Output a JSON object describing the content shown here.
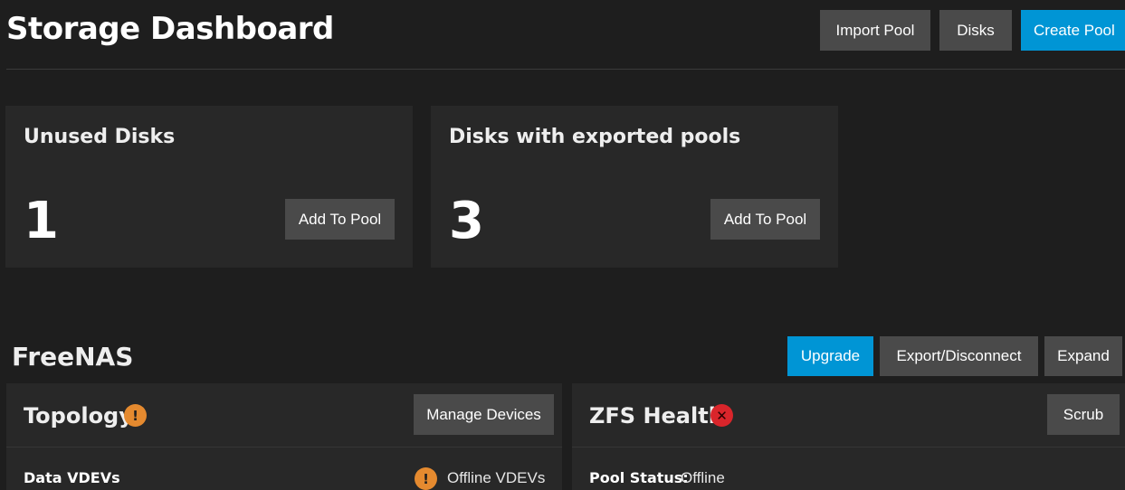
{
  "header": {
    "title": "Storage Dashboard",
    "buttons": {
      "import_pool": "Import Pool",
      "disks": "Disks",
      "create_pool": "Create Pool"
    }
  },
  "summary_cards": [
    {
      "title": "Unused Disks",
      "count": "1",
      "button": "Add To Pool"
    },
    {
      "title": "Disks with exported pools",
      "count": "3",
      "button": "Add To Pool"
    }
  ],
  "pool": {
    "name": "FreeNAS",
    "actions": {
      "upgrade": "Upgrade",
      "export_disconnect": "Export/Disconnect",
      "expand": "Expand"
    },
    "topology": {
      "title": "Topology",
      "status_icon": "warning-icon",
      "button": "Manage Devices",
      "row_label": "Data VDEVs",
      "row_value": "Offline VDEVs",
      "row_icon": "warning-icon"
    },
    "zfs_health": {
      "title": "ZFS Health",
      "status_icon": "error-icon",
      "button": "Scrub",
      "status_label": "Pool Status:",
      "status_value": "Offline"
    }
  },
  "colors": {
    "background": "#1e1e1e",
    "card": "#282828",
    "button": "#4a4a4a",
    "accent": "#0095d5",
    "warning": "#e58a2f",
    "error": "#d9252b"
  }
}
